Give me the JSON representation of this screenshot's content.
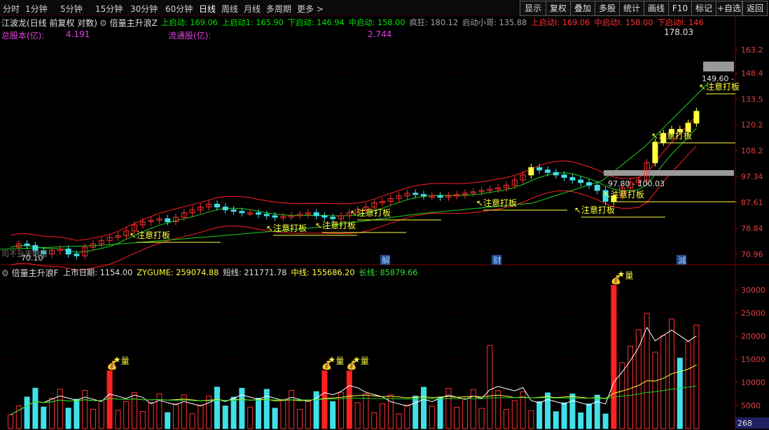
{
  "toolbar": {
    "periods": [
      "分时",
      "1分钟",
      "5分钟",
      "15分钟",
      "30分钟",
      "60分钟",
      "日线",
      "周线",
      "月线",
      "多周期",
      "更多"
    ],
    "more_arrow": ">",
    "buttons": [
      "显示",
      "复权",
      "叠加",
      "多股",
      "统计",
      "画线",
      "F10",
      "标记",
      "+自选",
      "返回"
    ]
  },
  "main_panel": {
    "stock_title": "江波龙(日线 前复权 对数)",
    "indicator_name": "倍量主升浪Z",
    "indicators": [
      {
        "label": "上启动",
        "value": "169.06",
        "color": "#00e000"
      },
      {
        "label": "上启动1",
        "value": "165.90",
        "color": "#00e000"
      },
      {
        "label": "下启动",
        "value": "146.94",
        "color": "#00e000"
      },
      {
        "label": "中启动",
        "value": "158.00",
        "color": "#00e000"
      },
      {
        "label": "疯狂",
        "value": "180.12",
        "color": "#a0a0a0"
      },
      {
        "label": "启动小哥",
        "value": "135.88",
        "color": "#a0a0a0"
      },
      {
        "label": "上启动I",
        "value": "169.06",
        "color": "#ff3030"
      },
      {
        "label": "中启动I",
        "value": "158.00",
        "color": "#ff3030"
      },
      {
        "label": "下启动I",
        "value": "146",
        "color": "#ff3030"
      }
    ],
    "total_shares_label": "总股本(亿):",
    "total_shares_value": "4.191",
    "float_shares_label": "流通股(亿):",
    "float_shares_value": "2.744",
    "price_axis": [
      "163.2",
      "148.4",
      "133.5",
      "120.2",
      "108.2",
      "97.34",
      "87.61",
      "78.84",
      "70.96"
    ],
    "high_mark": "178.03",
    "low_mark": "70.10",
    "range_label_1": "97.80 - 100.03",
    "range_label_2": "149.60 -",
    "signal_text": "注意打板",
    "event_markers": [
      "解",
      "财",
      "減"
    ],
    "low_left_text": "70.10",
    "left_faded_text": "司不业来融资"
  },
  "volume_panel": {
    "indicator_name": "倍量主升浪F",
    "items": [
      {
        "label": "上市日期",
        "value": "1154.00",
        "color": "#e0e0e0"
      },
      {
        "label": "ZYGUME",
        "value": "259074.88",
        "color": "#ffff40"
      },
      {
        "label": "短线",
        "value": "211771.78",
        "color": "#e0e0e0"
      },
      {
        "label": "中线",
        "value": "155686.20",
        "color": "#ffff40"
      },
      {
        "label": "长线",
        "value": "85879.66",
        "color": "#30e030"
      }
    ],
    "axis": [
      "30000",
      "25000",
      "20000",
      "15000",
      "10000",
      "5000"
    ],
    "marker_text": "量",
    "corner_value": "268"
  },
  "colors": {
    "up": "#ff3030",
    "down": "#40e0e8",
    "signal": "#ffff40",
    "grid": "#500000",
    "ma_green": "#20d020",
    "ma_red": "#ff2020"
  }
}
